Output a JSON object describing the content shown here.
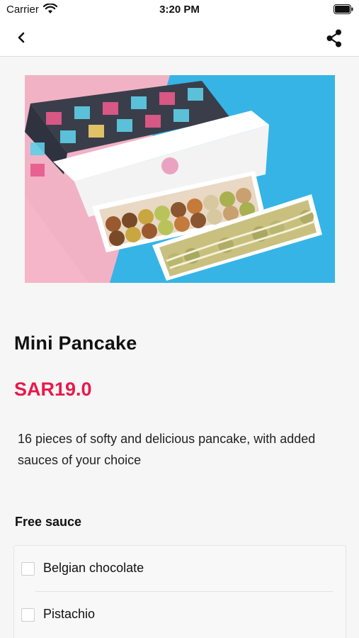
{
  "status_bar": {
    "carrier": "Carrier",
    "time": "3:20 PM",
    "wifi_icon": "wifi-icon",
    "battery_icon": "battery-icon"
  },
  "nav": {
    "back_icon": "chevron-left-icon",
    "share_icon": "share-icon"
  },
  "product": {
    "image_alt": "Mini pancake gift box photo",
    "title": "Mini Pancake",
    "price": "SAR19.0",
    "description": "16 pieces of softy and delicious pancake, with added sauces of your choice"
  },
  "options": {
    "section_title": "Free sauce",
    "items": [
      {
        "label": "Belgian chocolate",
        "checked": false
      },
      {
        "label": "Pistachio",
        "checked": false
      }
    ]
  },
  "colors": {
    "price": "#e8194b",
    "background": "#f6f6f6"
  }
}
